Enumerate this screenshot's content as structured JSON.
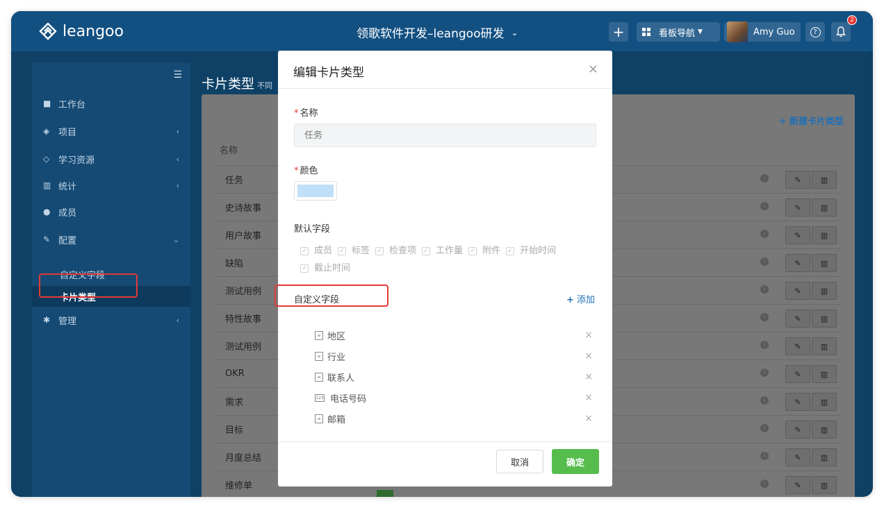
{
  "header": {
    "logo_text": "leangoo",
    "project_title": "领歌软件开发–leangoo研发",
    "board_nav": "看板导航",
    "user_name": "Amy Guo",
    "notification_count": "2"
  },
  "sidebar": {
    "items": [
      {
        "label": "工作台",
        "icon": "grid-icon"
      },
      {
        "label": "项目",
        "icon": "layers-icon"
      },
      {
        "label": "学习资源",
        "icon": "graduation-cap-icon"
      },
      {
        "label": "统计",
        "icon": "bar-chart-icon"
      },
      {
        "label": "成员",
        "icon": "users-icon"
      },
      {
        "label": "配置",
        "icon": "wrench-icon"
      },
      {
        "label": "管理",
        "icon": "gear-icon"
      }
    ],
    "sub_items": [
      {
        "label": "自定义字段"
      },
      {
        "label": "卡片类型"
      }
    ]
  },
  "main": {
    "title": "卡片类型",
    "title_suffix": "不同",
    "new_type_label": "新建卡片类型",
    "column_name": "名称",
    "rows": [
      "任务",
      "史诗故事",
      "用户故事",
      "缺陷",
      "测试用例",
      "特性故事",
      "测试用例",
      "OKR",
      "需求",
      "目标",
      "月度总结",
      "维修单"
    ]
  },
  "modal": {
    "title": "编辑卡片类型",
    "name_label": "名称",
    "name_placeholder": "任务",
    "color_label": "颜色",
    "color_value": "#bfe0f8",
    "default_fields_label": "默认字段",
    "default_fields": [
      "成员",
      "标签",
      "检查项",
      "工作量",
      "附件",
      "开始时间",
      "截止时间"
    ],
    "custom_fields_label": "自定义字段",
    "add_label": "添加",
    "custom_fields": [
      {
        "label": "地区",
        "icon": "document-icon"
      },
      {
        "label": "行业",
        "icon": "document-icon"
      },
      {
        "label": "联系人",
        "icon": "document-icon"
      },
      {
        "label": "电话号码",
        "icon": "number-icon"
      },
      {
        "label": "邮箱",
        "icon": "document-icon"
      }
    ],
    "cancel_label": "取消",
    "ok_label": "确定"
  }
}
